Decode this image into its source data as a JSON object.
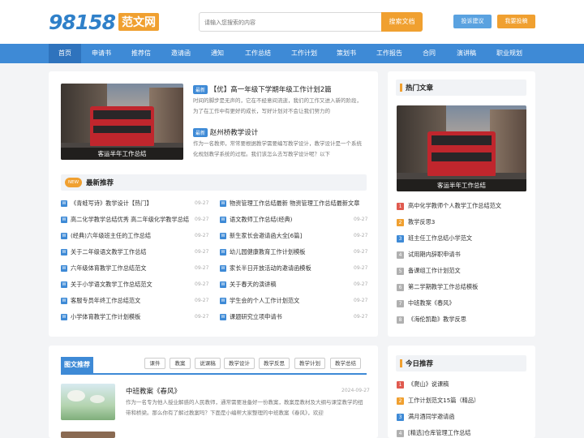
{
  "header": {
    "logo_number": "98158",
    "logo_text": "范文网",
    "search_placeholder": "请输入您搜索的内容",
    "search_button": "搜索文档",
    "suggest_button": "投诉建议",
    "submit_button": "我要投稿"
  },
  "nav": {
    "items": [
      "首页",
      "申请书",
      "推荐信",
      "邀请函",
      "通知",
      "工作总结",
      "工作计划",
      "策划书",
      "工作报告",
      "合同",
      "演讲稿",
      "职业规划"
    ]
  },
  "featured": {
    "image_caption": "客运半年工作总结",
    "leads": [
      {
        "badge": "最新",
        "title": "【优】高一年级下学期年级工作计划2篇",
        "desc": "时间的脚步是无声的，它在不经意间流逝，我们的工作又进入新的阶段，为了在工作中有更好的成长，写好计划对不会让我们努力的"
      },
      {
        "badge": "最新",
        "title": "赵州桥教学设计",
        "desc": "作为一名教师，常常要根据教学需要编写教学设计，教学设计是一个系统化规划教学系统的过程。我们该怎么去写教学设计呢？以下"
      }
    ]
  },
  "latest": {
    "tag": "NEW",
    "title": "最新推荐",
    "icon_letter": "W",
    "left": [
      {
        "text": "《青蛙写诗》教学设计【热门】",
        "date": "09-27"
      },
      {
        "text": "高二化学教学总结优秀 高二年级化学教学总结",
        "date": "09-27"
      },
      {
        "text": "(经典)六年级班主任的工作总结",
        "date": "09-27"
      },
      {
        "text": "关于二年级语文教学工作总结",
        "date": "09-27"
      },
      {
        "text": "六年级体育教学工作总结范文",
        "date": "09-27"
      },
      {
        "text": "关于小学语文教学工作总结范文",
        "date": "09-27"
      },
      {
        "text": "客服专员年终工作总结范文",
        "date": "09-27"
      },
      {
        "text": "小学体育教学工作计划模板",
        "date": "09-27"
      }
    ],
    "right": [
      {
        "text": "物资管理工作总结最新 物资管理工作总结最新文章",
        "date": "09-27"
      },
      {
        "text": "语文教师工作总结(经典)",
        "date": "09-27"
      },
      {
        "text": "新生家长会邀请函大全[6篇]",
        "date": "09-27"
      },
      {
        "text": "幼儿园健康教育工作计划模板",
        "date": "09-27"
      },
      {
        "text": "家长半日开放活动的邀请函模板",
        "date": "09-27"
      },
      {
        "text": "关于春天的演讲稿",
        "date": "09-27"
      },
      {
        "text": "学生会的个人工作计划范文",
        "date": "09-27"
      },
      {
        "text": "课题研究立项申请书",
        "date": "09-27"
      }
    ]
  },
  "hot": {
    "title": "热门文章",
    "image_caption": "客运半年工作总结",
    "items": [
      {
        "num": "1",
        "text": "高中化学教师个人教学工作总结范文",
        "color": "#e05a4f"
      },
      {
        "num": "2",
        "text": "教学反思3",
        "color": "#f0a030"
      },
      {
        "num": "3",
        "text": "班主任工作总结小学范文",
        "color": "#3e8ad6"
      },
      {
        "num": "4",
        "text": "试用期内辞职申请书",
        "color": "#b0b0b0"
      },
      {
        "num": "5",
        "text": "备课组工作计划范文",
        "color": "#b0b0b0"
      },
      {
        "num": "6",
        "text": "第二学期教学工作总结模板",
        "color": "#b0b0b0"
      },
      {
        "num": "7",
        "text": "中班教案《春风》",
        "color": "#b0b0b0"
      },
      {
        "num": "8",
        "text": "《海伦凯勒》教学反思",
        "color": "#b0b0b0"
      }
    ]
  },
  "photo": {
    "title": "图文推荐",
    "chips": [
      "课件",
      "教案",
      "说课稿",
      "教学设计",
      "教学反思",
      "教学计划",
      "教学总结"
    ],
    "article_title": "中班教案《春风》",
    "article_date": "2024-09-27",
    "article_desc": "作为一名专为他人授业解惑的人民教师，通常需要准备好一份教案，教案是教材及大纲与课堂教学的纽带和桥梁。那么你有了解过教案吗？下面是小编帮大家整理的中班教案《春风》，欢迎"
  },
  "today": {
    "title": "今日推荐",
    "items": [
      {
        "num": "1",
        "text": "《爬山》说课稿",
        "color": "#e05a4f"
      },
      {
        "num": "2",
        "text": "工作计划范文15篇（精品）",
        "color": "#f0a030"
      },
      {
        "num": "3",
        "text": "满月酒同学邀请函",
        "color": "#3e8ad6"
      },
      {
        "num": "4",
        "text": "[精选]仓库管理工作总结",
        "color": "#b0b0b0"
      }
    ]
  }
}
